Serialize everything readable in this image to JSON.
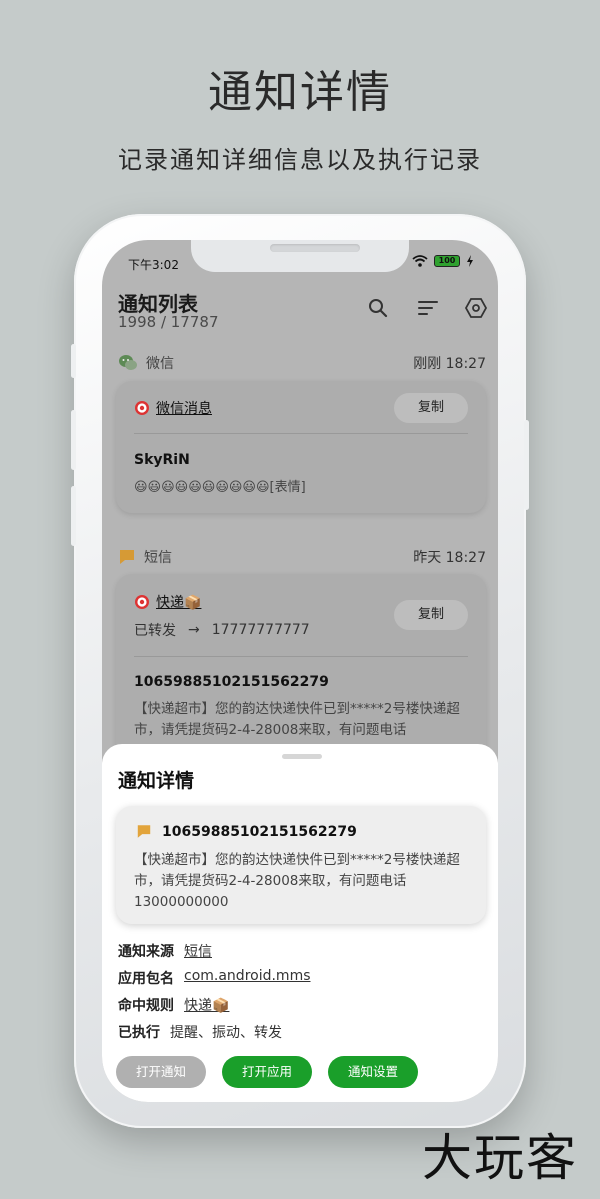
{
  "promo": {
    "headline": "通知详情",
    "subline": "记录通知详细信息以及执行记录"
  },
  "status_bar": {
    "time": "下午3:02",
    "battery": "100"
  },
  "header": {
    "title": "通知列表",
    "count": "1998 / 17787"
  },
  "notifications": [
    {
      "app": "微信",
      "time": "刚刚 18:27",
      "rule": "微信消息",
      "copy_label": "复制",
      "sender": "SkyRiN",
      "content": "😃😃😃😃😃😃😃😃😃😃[表情]"
    },
    {
      "app": "短信",
      "time": "昨天 18:27",
      "rule": "快递📦",
      "copy_label": "复制",
      "forward_label": "已转发",
      "forward_arrow": "→",
      "forward_to": "17777777777",
      "sender": "1065988510215156227​9",
      "content": "【快递超市】您的韵达快递快件已到*****2号楼快递超市，请凭提货码2-4-28008来取，有问题电话13000000000"
    }
  ],
  "sheet": {
    "title": "通知详情",
    "card_sender": "10659885102151562279",
    "card_content": "【快递超市】您的韵达快递快件已到*****2号楼快递超市，请凭提货码2-4-28008来取，有问题电话13000000000",
    "rows": [
      {
        "label": "通知来源",
        "value": "短信"
      },
      {
        "label": "应用包名",
        "value": "com.android.mms"
      },
      {
        "label": "命中规则",
        "value": "快递📦"
      },
      {
        "label": "已执行",
        "value": "提醒、振动、转发"
      }
    ],
    "buttons": [
      "打开通知",
      "打开应用",
      "通知设置"
    ]
  },
  "watermark": "大玩客",
  "colors": {
    "background": "#c5cbca",
    "accent_green": "#1a9f2a",
    "disabled_gray": "#b0b0b0"
  }
}
